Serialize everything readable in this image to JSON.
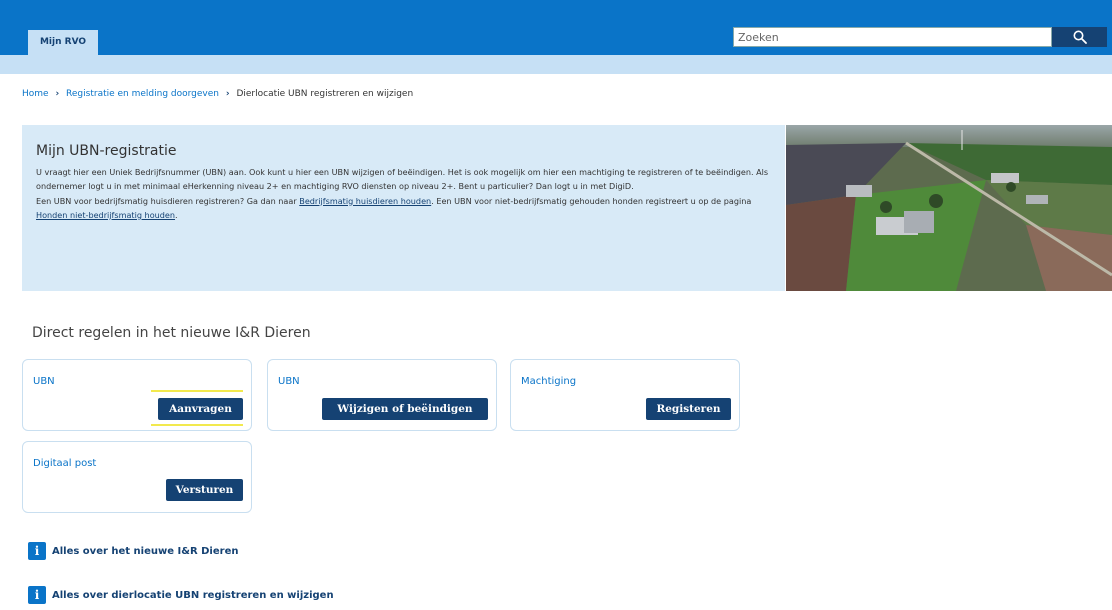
{
  "header": {
    "tab_label": "Mijn RVO",
    "search_placeholder": "Zoeken"
  },
  "breadcrumb": {
    "items": [
      "Home",
      "Registratie en melding doorgeven"
    ],
    "current": "Dierlocatie UBN registreren en wijzigen"
  },
  "hero": {
    "title": "Mijn UBN-registratie",
    "text_1": "U vraagt hier een Uniek Bedrijfsnummer (UBN) aan. Ook kunt u hier een UBN wijzigen of beëindigen. Het is ook mogelijk om hier een machtiging te registreren of te beëindigen. Als ondernemer logt u in met minimaal eHerkenning niveau 2+ en machtiging RVO diensten op niveau 2+. Bent u particulier? Dan logt u in met DigiD.",
    "text_2a": "Een UBN voor bedrijfsmatig huisdieren registreren? Ga dan naar ",
    "link_1": "Bedrijfsmatig huisdieren houden",
    "text_2b": ". Een UBN voor niet-bedrijfsmatig gehouden honden registreert u op de pagina ",
    "link_2": "Honden niet-bedrijfsmatig houden",
    "text_2c": "."
  },
  "section_title": "Direct regelen in het nieuwe I&R Dieren",
  "cards": [
    {
      "label": "UBN",
      "button": "Aanvragen"
    },
    {
      "label": "UBN",
      "button": "Wijzigen of beëindigen"
    },
    {
      "label": "Machtiging",
      "button": "Registeren"
    },
    {
      "label": "Digitaal post",
      "button": "Versturen"
    }
  ],
  "info_links": [
    {
      "icon": "i",
      "label": "Alles over het nieuwe I&R Dieren"
    },
    {
      "icon": "i",
      "label": "Alles over dierlocatie UBN registreren en wijzigen"
    }
  ],
  "colors": {
    "brand_blue": "#0a74c8",
    "dark_navy": "#154273",
    "light_blue": "#c6e0f5",
    "hero_bg": "#d8eaf7",
    "highlight": "#f2e94e"
  }
}
